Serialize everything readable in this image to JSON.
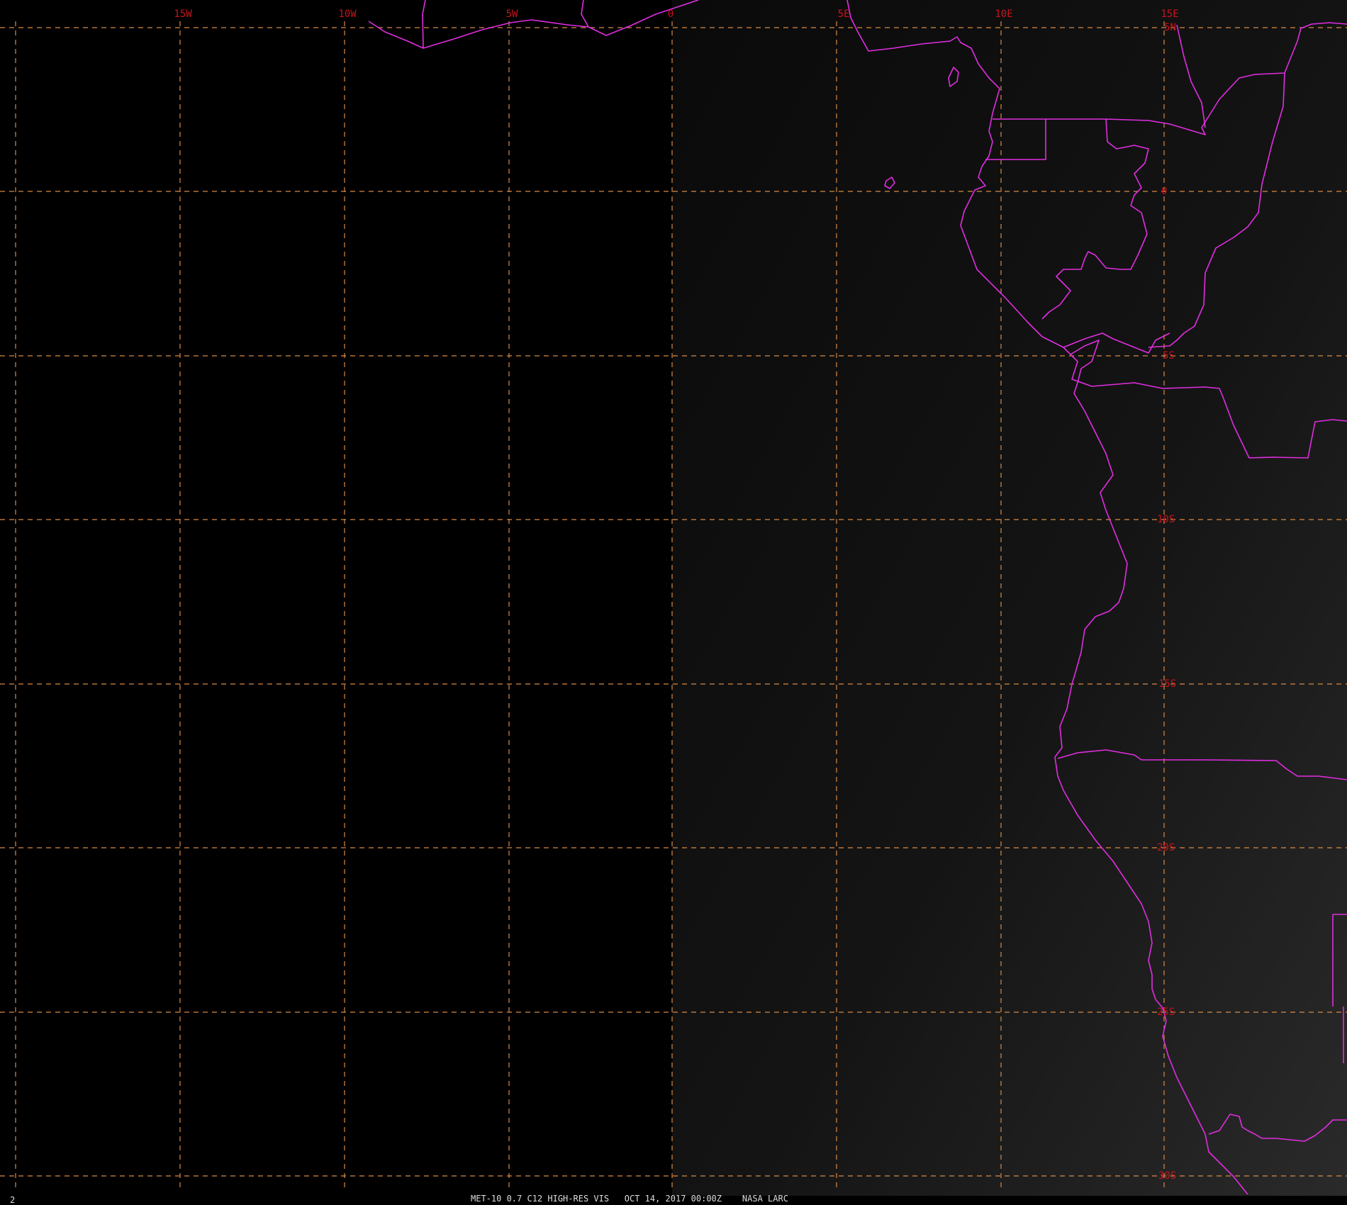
{
  "map": {
    "footer": "MET-10 0.7 C12 HIGH-RES VIS   OCT 14, 2017 00:00Z    NASA LARC",
    "frame_number": "2",
    "longitude_labels": [
      "15W",
      "10W",
      "5W",
      "0",
      "5E",
      "10E",
      "15E"
    ],
    "latitude_labels": [
      "5N",
      "0",
      "5S",
      "10S",
      "15S",
      "20S",
      "25S",
      "30S"
    ],
    "colors": {
      "background": "#000000",
      "imagery_day_side": "#131313",
      "grid": "#d88a45",
      "grid_labels": "#c8141e",
      "coastlines_borders": "#e02ee0",
      "footer_text": "#dcdcdc",
      "frame_number": "#e6e600"
    }
  }
}
